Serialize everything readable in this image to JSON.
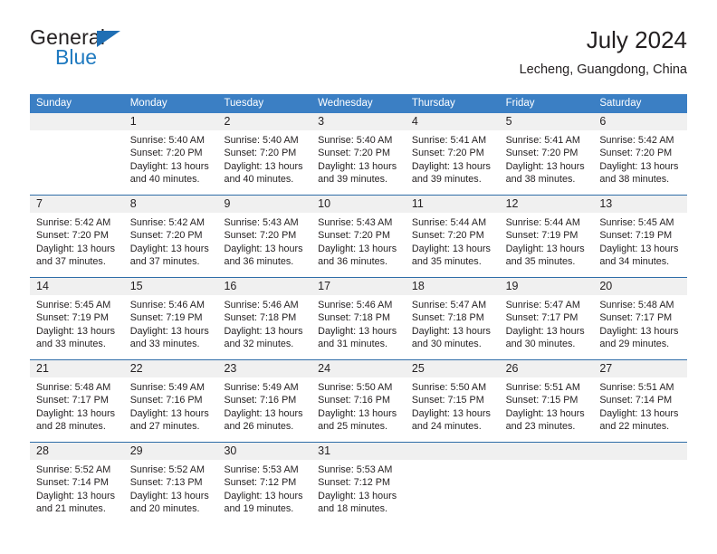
{
  "brand": {
    "name_part1": "General",
    "name_part2": "Blue",
    "triangle_color": "#1f6fb4",
    "blue_color": "#1f7ac0"
  },
  "header": {
    "title": "July 2024",
    "subtitle": "Lecheng, Guangdong, China",
    "header_bg": "#3b7fc4",
    "daynum_bg": "#f0f0f0",
    "divider_color": "#2f6da8"
  },
  "weekdays": [
    "Sunday",
    "Monday",
    "Tuesday",
    "Wednesday",
    "Thursday",
    "Friday",
    "Saturday"
  ],
  "weeks": [
    [
      {
        "day": "",
        "sunrise": "",
        "sunset": "",
        "daylight_line1": "",
        "daylight_line2": ""
      },
      {
        "day": "1",
        "sunrise": "Sunrise: 5:40 AM",
        "sunset": "Sunset: 7:20 PM",
        "daylight_line1": "Daylight: 13 hours",
        "daylight_line2": "and 40 minutes."
      },
      {
        "day": "2",
        "sunrise": "Sunrise: 5:40 AM",
        "sunset": "Sunset: 7:20 PM",
        "daylight_line1": "Daylight: 13 hours",
        "daylight_line2": "and 40 minutes."
      },
      {
        "day": "3",
        "sunrise": "Sunrise: 5:40 AM",
        "sunset": "Sunset: 7:20 PM",
        "daylight_line1": "Daylight: 13 hours",
        "daylight_line2": "and 39 minutes."
      },
      {
        "day": "4",
        "sunrise": "Sunrise: 5:41 AM",
        "sunset": "Sunset: 7:20 PM",
        "daylight_line1": "Daylight: 13 hours",
        "daylight_line2": "and 39 minutes."
      },
      {
        "day": "5",
        "sunrise": "Sunrise: 5:41 AM",
        "sunset": "Sunset: 7:20 PM",
        "daylight_line1": "Daylight: 13 hours",
        "daylight_line2": "and 38 minutes."
      },
      {
        "day": "6",
        "sunrise": "Sunrise: 5:42 AM",
        "sunset": "Sunset: 7:20 PM",
        "daylight_line1": "Daylight: 13 hours",
        "daylight_line2": "and 38 minutes."
      }
    ],
    [
      {
        "day": "7",
        "sunrise": "Sunrise: 5:42 AM",
        "sunset": "Sunset: 7:20 PM",
        "daylight_line1": "Daylight: 13 hours",
        "daylight_line2": "and 37 minutes."
      },
      {
        "day": "8",
        "sunrise": "Sunrise: 5:42 AM",
        "sunset": "Sunset: 7:20 PM",
        "daylight_line1": "Daylight: 13 hours",
        "daylight_line2": "and 37 minutes."
      },
      {
        "day": "9",
        "sunrise": "Sunrise: 5:43 AM",
        "sunset": "Sunset: 7:20 PM",
        "daylight_line1": "Daylight: 13 hours",
        "daylight_line2": "and 36 minutes."
      },
      {
        "day": "10",
        "sunrise": "Sunrise: 5:43 AM",
        "sunset": "Sunset: 7:20 PM",
        "daylight_line1": "Daylight: 13 hours",
        "daylight_line2": "and 36 minutes."
      },
      {
        "day": "11",
        "sunrise": "Sunrise: 5:44 AM",
        "sunset": "Sunset: 7:20 PM",
        "daylight_line1": "Daylight: 13 hours",
        "daylight_line2": "and 35 minutes."
      },
      {
        "day": "12",
        "sunrise": "Sunrise: 5:44 AM",
        "sunset": "Sunset: 7:19 PM",
        "daylight_line1": "Daylight: 13 hours",
        "daylight_line2": "and 35 minutes."
      },
      {
        "day": "13",
        "sunrise": "Sunrise: 5:45 AM",
        "sunset": "Sunset: 7:19 PM",
        "daylight_line1": "Daylight: 13 hours",
        "daylight_line2": "and 34 minutes."
      }
    ],
    [
      {
        "day": "14",
        "sunrise": "Sunrise: 5:45 AM",
        "sunset": "Sunset: 7:19 PM",
        "daylight_line1": "Daylight: 13 hours",
        "daylight_line2": "and 33 minutes."
      },
      {
        "day": "15",
        "sunrise": "Sunrise: 5:46 AM",
        "sunset": "Sunset: 7:19 PM",
        "daylight_line1": "Daylight: 13 hours",
        "daylight_line2": "and 33 minutes."
      },
      {
        "day": "16",
        "sunrise": "Sunrise: 5:46 AM",
        "sunset": "Sunset: 7:18 PM",
        "daylight_line1": "Daylight: 13 hours",
        "daylight_line2": "and 32 minutes."
      },
      {
        "day": "17",
        "sunrise": "Sunrise: 5:46 AM",
        "sunset": "Sunset: 7:18 PM",
        "daylight_line1": "Daylight: 13 hours",
        "daylight_line2": "and 31 minutes."
      },
      {
        "day": "18",
        "sunrise": "Sunrise: 5:47 AM",
        "sunset": "Sunset: 7:18 PM",
        "daylight_line1": "Daylight: 13 hours",
        "daylight_line2": "and 30 minutes."
      },
      {
        "day": "19",
        "sunrise": "Sunrise: 5:47 AM",
        "sunset": "Sunset: 7:17 PM",
        "daylight_line1": "Daylight: 13 hours",
        "daylight_line2": "and 30 minutes."
      },
      {
        "day": "20",
        "sunrise": "Sunrise: 5:48 AM",
        "sunset": "Sunset: 7:17 PM",
        "daylight_line1": "Daylight: 13 hours",
        "daylight_line2": "and 29 minutes."
      }
    ],
    [
      {
        "day": "21",
        "sunrise": "Sunrise: 5:48 AM",
        "sunset": "Sunset: 7:17 PM",
        "daylight_line1": "Daylight: 13 hours",
        "daylight_line2": "and 28 minutes."
      },
      {
        "day": "22",
        "sunrise": "Sunrise: 5:49 AM",
        "sunset": "Sunset: 7:16 PM",
        "daylight_line1": "Daylight: 13 hours",
        "daylight_line2": "and 27 minutes."
      },
      {
        "day": "23",
        "sunrise": "Sunrise: 5:49 AM",
        "sunset": "Sunset: 7:16 PM",
        "daylight_line1": "Daylight: 13 hours",
        "daylight_line2": "and 26 minutes."
      },
      {
        "day": "24",
        "sunrise": "Sunrise: 5:50 AM",
        "sunset": "Sunset: 7:16 PM",
        "daylight_line1": "Daylight: 13 hours",
        "daylight_line2": "and 25 minutes."
      },
      {
        "day": "25",
        "sunrise": "Sunrise: 5:50 AM",
        "sunset": "Sunset: 7:15 PM",
        "daylight_line1": "Daylight: 13 hours",
        "daylight_line2": "and 24 minutes."
      },
      {
        "day": "26",
        "sunrise": "Sunrise: 5:51 AM",
        "sunset": "Sunset: 7:15 PM",
        "daylight_line1": "Daylight: 13 hours",
        "daylight_line2": "and 23 minutes."
      },
      {
        "day": "27",
        "sunrise": "Sunrise: 5:51 AM",
        "sunset": "Sunset: 7:14 PM",
        "daylight_line1": "Daylight: 13 hours",
        "daylight_line2": "and 22 minutes."
      }
    ],
    [
      {
        "day": "28",
        "sunrise": "Sunrise: 5:52 AM",
        "sunset": "Sunset: 7:14 PM",
        "daylight_line1": "Daylight: 13 hours",
        "daylight_line2": "and 21 minutes."
      },
      {
        "day": "29",
        "sunrise": "Sunrise: 5:52 AM",
        "sunset": "Sunset: 7:13 PM",
        "daylight_line1": "Daylight: 13 hours",
        "daylight_line2": "and 20 minutes."
      },
      {
        "day": "30",
        "sunrise": "Sunrise: 5:53 AM",
        "sunset": "Sunset: 7:12 PM",
        "daylight_line1": "Daylight: 13 hours",
        "daylight_line2": "and 19 minutes."
      },
      {
        "day": "31",
        "sunrise": "Sunrise: 5:53 AM",
        "sunset": "Sunset: 7:12 PM",
        "daylight_line1": "Daylight: 13 hours",
        "daylight_line2": "and 18 minutes."
      },
      {
        "day": "",
        "sunrise": "",
        "sunset": "",
        "daylight_line1": "",
        "daylight_line2": ""
      },
      {
        "day": "",
        "sunrise": "",
        "sunset": "",
        "daylight_line1": "",
        "daylight_line2": ""
      },
      {
        "day": "",
        "sunrise": "",
        "sunset": "",
        "daylight_line1": "",
        "daylight_line2": ""
      }
    ]
  ]
}
